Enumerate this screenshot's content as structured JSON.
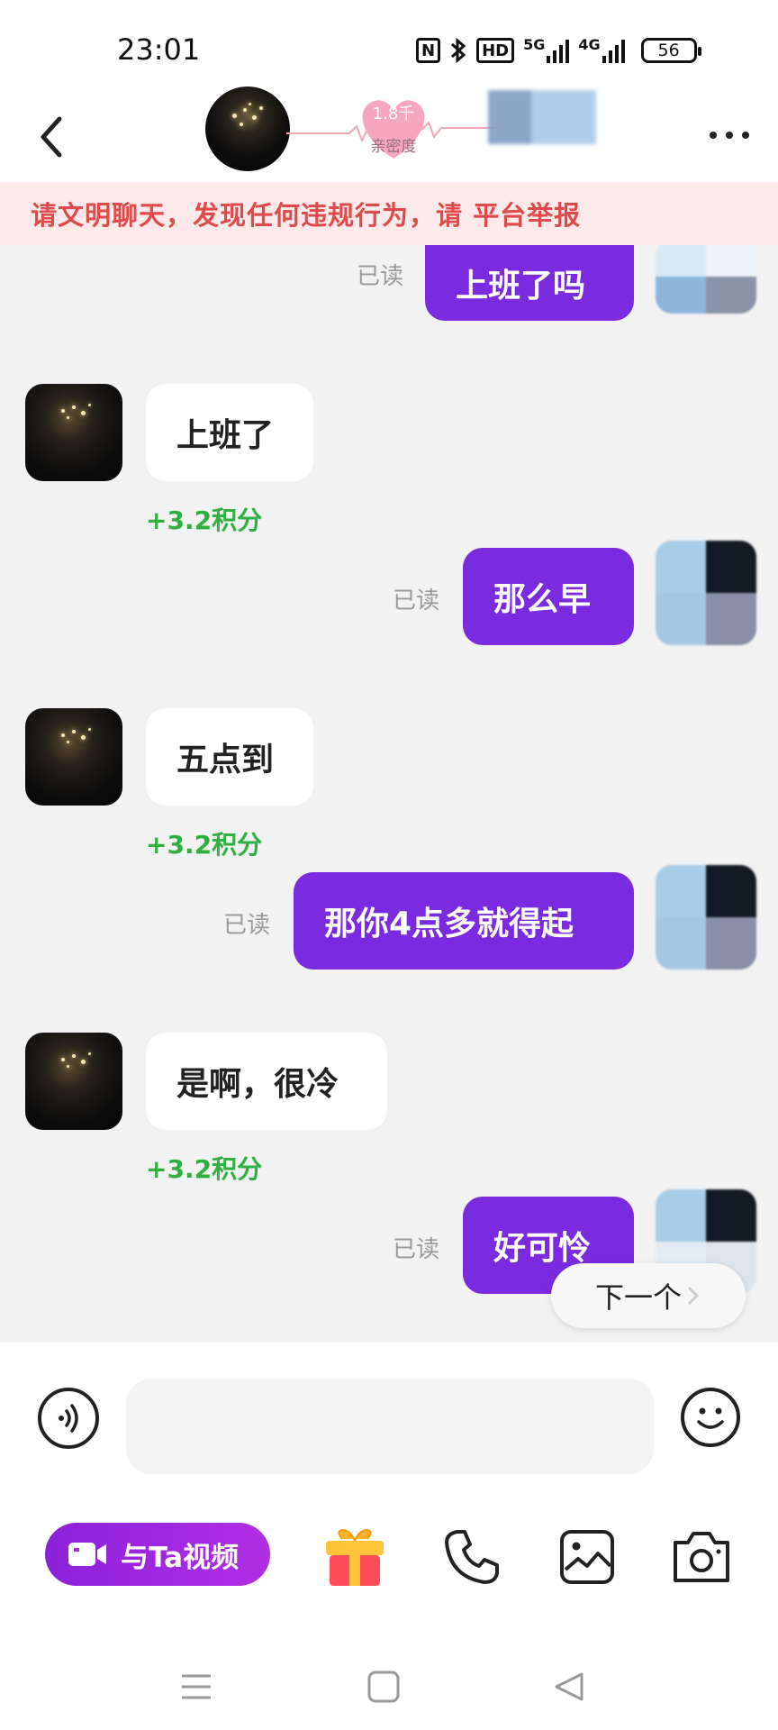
{
  "status_bar": {
    "time": "23:01",
    "icons": [
      "nfc-icon",
      "bluetooth-icon",
      "hd-icon",
      "5g-signal-icon",
      "4g-signal-icon"
    ],
    "hd_label": "HD",
    "network_5g": "5G",
    "network_4g": "4G",
    "battery": "56"
  },
  "header": {
    "intimacy_value": "1.8千",
    "intimacy_label": "亲密度"
  },
  "banner": {
    "text": "请文明聊天，发现任何违规行为，请        平台举报"
  },
  "messages": [
    {
      "side": "out",
      "text": "上班了吗",
      "status": "已读"
    },
    {
      "side": "in",
      "text": "上班了",
      "points": "+3.2积分"
    },
    {
      "side": "out",
      "text": "那么早",
      "status": "已读"
    },
    {
      "side": "in",
      "text": "五点到",
      "points": "+3.2积分"
    },
    {
      "side": "out",
      "text": "那你4点多就得起",
      "status": "已读"
    },
    {
      "side": "in",
      "text": "是啊，很冷",
      "points": "+3.2积分"
    },
    {
      "side": "out",
      "text": "好可怜",
      "status": "已读"
    }
  ],
  "next_button": "下一个",
  "input": {
    "placeholder": ""
  },
  "toolbar": {
    "video_label": "与Ta视频"
  },
  "colors": {
    "accent_purple": "#7a2be0",
    "points_green": "#2fb040",
    "warning_red": "#e04a4a",
    "banner_bg": "#fde9ea"
  }
}
